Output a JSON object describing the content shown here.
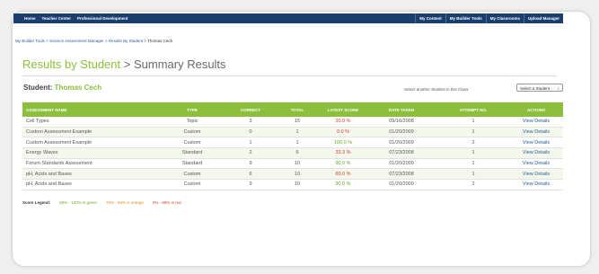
{
  "nav": {
    "left": [
      "Home",
      "Teacher Center",
      "Professional Development"
    ],
    "right": [
      "My Content",
      "My Builder Tools",
      "My Classrooms",
      "Upload Manager"
    ]
  },
  "breadcrumb": {
    "links": [
      "My Builder Tools",
      "Science Assessment Manager",
      "Results By Student"
    ],
    "separator": ">",
    "current": "Thomas Cech"
  },
  "page": {
    "title_main": "Results by Student",
    "title_sep": ">",
    "title_sub": "Summary Results"
  },
  "student": {
    "label": "Student:",
    "name": "Thomas Cech",
    "select_label": "Select another Student in this Class:",
    "select_value": "Select a Student"
  },
  "table": {
    "headers": [
      "ASSESSMENT NAME",
      "TYPE",
      "CORRECT",
      "TOTAL",
      "LATEST SCORE",
      "DATE TAKEN",
      "ATTEMPT NO.",
      "ACTIONS"
    ],
    "rows": [
      {
        "name": "Cell Types",
        "type": "Topic",
        "correct": "3",
        "total": "15",
        "score": "20.0 %",
        "date": "09/16/2008",
        "attempt": "1",
        "action": "View Details",
        "score_color": "red"
      },
      {
        "name": "Custom Assessment Example",
        "type": "Custom",
        "correct": "0",
        "total": "1",
        "score": "0.0 %",
        "date": "01/20/2009",
        "attempt": "1",
        "action": "View Details",
        "score_color": "red"
      },
      {
        "name": "Custom Assessment Example",
        "type": "Custom",
        "correct": "1",
        "total": "1",
        "score": "100.0 %",
        "date": "01/20/2009",
        "attempt": "2",
        "action": "View Details",
        "score_color": "green"
      },
      {
        "name": "Energy Waves",
        "type": "Standard",
        "correct": "2",
        "total": "6",
        "score": "33.3 %",
        "date": "07/23/2008",
        "attempt": "1",
        "action": "View Details",
        "score_color": "red"
      },
      {
        "name": "Forum Standards Assessment",
        "type": "Standard",
        "correct": "9",
        "total": "10",
        "score": "90.0 %",
        "date": "01/20/2009",
        "attempt": "1",
        "action": "View Details",
        "score_color": "green"
      },
      {
        "name": "pH, Acids and Bases",
        "type": "Custom",
        "correct": "6",
        "total": "10",
        "score": "60.0 %",
        "date": "07/23/2008",
        "attempt": "1",
        "action": "View Details",
        "score_color": "red"
      },
      {
        "name": "pH, Acids and Bases",
        "type": "Custom",
        "correct": "9",
        "total": "10",
        "score": "90.0 %",
        "date": "01/20/2009",
        "attempt": "2",
        "action": "View Details",
        "score_color": "green"
      }
    ]
  },
  "legend": {
    "label": "Score Legend:",
    "green": "85% - 100% is green",
    "orange": "70% - 84% is orange",
    "red": "0% - 69% is red"
  },
  "colors": {
    "nav_bg": "#1a3f6f",
    "accent_green": "#8bbf3c",
    "score_red": "#d33b2a",
    "score_green": "#6aa822",
    "score_orange": "#e28a1a",
    "link_blue": "#2a5d9a"
  },
  "icons": {
    "select_arrow": "chevron-down-icon"
  }
}
